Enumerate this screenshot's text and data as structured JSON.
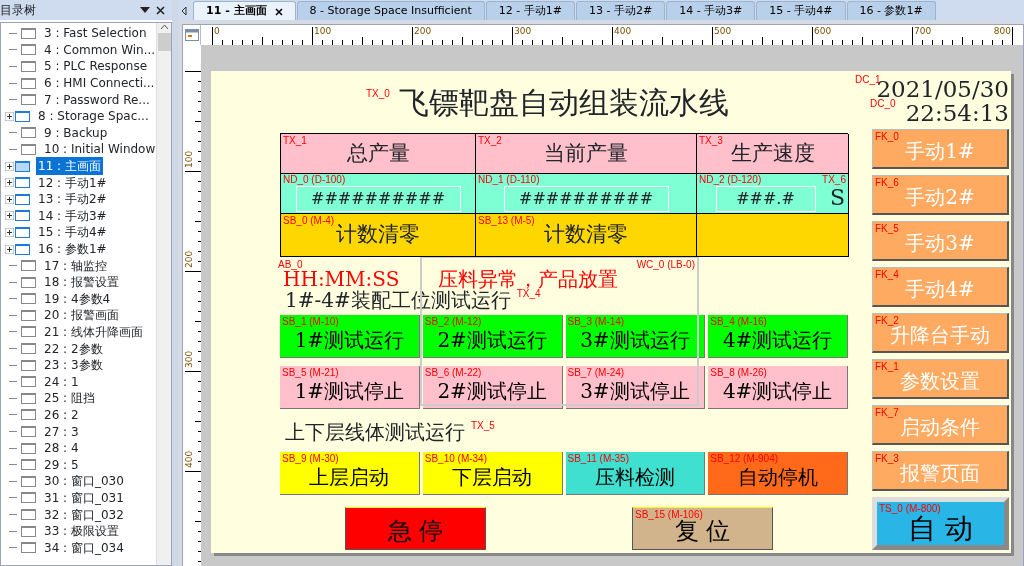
{
  "panel": {
    "title": "目录树",
    "tree": [
      {
        "label": "3 : Fast Selection",
        "expandable": false,
        "selected": false
      },
      {
        "label": "4 : Common Win...",
        "expandable": false,
        "selected": false
      },
      {
        "label": "5 : PLC Response",
        "expandable": false,
        "selected": false
      },
      {
        "label": "6 : HMI Connecti...",
        "expandable": false,
        "selected": false
      },
      {
        "label": "7 : Password Re...",
        "expandable": false,
        "selected": false
      },
      {
        "label": "8 : Storage Spac...",
        "expandable": true,
        "selected": false
      },
      {
        "label": "9 : Backup",
        "expandable": false,
        "selected": false
      },
      {
        "label": "10 : Initial Window",
        "expandable": false,
        "selected": false
      },
      {
        "label": "11 : 主画面",
        "expandable": true,
        "selected": true
      },
      {
        "label": "12 : 手动1#",
        "expandable": true,
        "selected": false
      },
      {
        "label": "13 : 手动2#",
        "expandable": true,
        "selected": false
      },
      {
        "label": "14 : 手动3#",
        "expandable": true,
        "selected": false
      },
      {
        "label": "15 : 手动4#",
        "expandable": true,
        "selected": false
      },
      {
        "label": "16 : 参数1#",
        "expandable": true,
        "selected": false
      },
      {
        "label": "17 : 轴监控",
        "expandable": false,
        "selected": false
      },
      {
        "label": "18 : 报警设置",
        "expandable": false,
        "selected": false
      },
      {
        "label": "19 : 4参数4",
        "expandable": false,
        "selected": false
      },
      {
        "label": "20 : 报警画面",
        "expandable": false,
        "selected": false
      },
      {
        "label": "21 : 线体升降画面",
        "expandable": false,
        "selected": false
      },
      {
        "label": "22 : 2参数",
        "expandable": false,
        "selected": false
      },
      {
        "label": "23 : 3参数",
        "expandable": false,
        "selected": false
      },
      {
        "label": "24 : 1",
        "expandable": false,
        "selected": false
      },
      {
        "label": "25 : 阻挡",
        "expandable": false,
        "selected": false
      },
      {
        "label": "26 : 2",
        "expandable": false,
        "selected": false
      },
      {
        "label": "27 : 3",
        "expandable": false,
        "selected": false
      },
      {
        "label": "28 : 4",
        "expandable": false,
        "selected": false
      },
      {
        "label": "29 : 5",
        "expandable": false,
        "selected": false
      },
      {
        "label": "30 : 窗口_030",
        "expandable": false,
        "selected": false
      },
      {
        "label": "31 : 窗口_031",
        "expandable": false,
        "selected": false
      },
      {
        "label": "32 : 窗口_032",
        "expandable": false,
        "selected": false
      },
      {
        "label": "33 : 极限设置",
        "expandable": false,
        "selected": false
      },
      {
        "label": "34 : 窗口_034",
        "expandable": false,
        "selected": false
      }
    ]
  },
  "tabs": [
    {
      "label": "11 - 主画面",
      "selected": true
    },
    {
      "label": "8 - Storage Space Insufficient",
      "selected": false
    },
    {
      "label": "12 - 手动1#",
      "selected": false
    },
    {
      "label": "13 - 手动2#",
      "selected": false
    },
    {
      "label": "14 - 手动3#",
      "selected": false
    },
    {
      "label": "15 - 手动4#",
      "selected": false
    },
    {
      "label": "16 - 参数1#",
      "selected": false
    }
  ],
  "ruler": {
    "x_labels": [
      "0",
      "100",
      "200",
      "300",
      "400",
      "500",
      "600",
      "700",
      "800"
    ],
    "y_labels": [
      "100",
      "200",
      "300",
      "400"
    ]
  },
  "screen": {
    "title": {
      "tag": "TX_0",
      "text": "飞镖靶盘自动组装流水线"
    },
    "table": {
      "headers": [
        {
          "tag": "TX_1",
          "text": "总产量"
        },
        {
          "tag": "TX_2",
          "text": "当前产量"
        },
        {
          "tag": "TX_3",
          "text": "生产速度"
        }
      ],
      "displays": [
        {
          "tag": "ND_0 (D-100)",
          "value": "##########"
        },
        {
          "tag": "ND_1 (D-110)",
          "value": "##########"
        },
        {
          "tag": "ND_2 (D-120)",
          "value": "###.#",
          "unit": "S",
          "unit_tag": "TX_6"
        }
      ],
      "clear_buttons": [
        {
          "tag": "SB_0 (M-4)",
          "label": "计数清零"
        },
        {
          "tag": "SB_13 (M-5)",
          "label": "计数清零"
        }
      ]
    },
    "alarm": {
      "tag": "AB_0",
      "clock": "HH:MM:SS",
      "message": "压料异常，产品放置"
    },
    "frame_tag": "WC_0 (LB-0)",
    "sections": [
      {
        "tag": "TX_4",
        "heading": "1#-4#装配工位测试运行",
        "rows": [
          [
            {
              "tag": "SB_1 (M-10)",
              "label": "1#测试运行",
              "color": "#00ff00"
            },
            {
              "tag": "SB_2 (M-12)",
              "label": "2#测试运行",
              "color": "#00ff00"
            },
            {
              "tag": "SB_3 (M-14)",
              "label": "3#测试运行",
              "color": "#00ff00"
            },
            {
              "tag": "SB_4 (M-16)",
              "label": "4#测试运行",
              "color": "#00ff00"
            }
          ],
          [
            {
              "tag": "SB_5 (M-21)",
              "label": "1#测试停止",
              "color": "#ffc0cb"
            },
            {
              "tag": "SB_6 (M-22)",
              "label": "2#测试停止",
              "color": "#ffc0cb"
            },
            {
              "tag": "SB_7 (M-24)",
              "label": "3#测试停止",
              "color": "#ffc0cb"
            },
            {
              "tag": "SB_8 (M-26)",
              "label": "4#测试停止",
              "color": "#ffc0cb"
            }
          ]
        ]
      },
      {
        "tag": "TX_5",
        "heading": "上下层线体测试运行",
        "rows": [
          [
            {
              "tag": "SB_9 (M-30)",
              "label": "上层启动",
              "color": "#ffff00"
            },
            {
              "tag": "SB_10 (M-34)",
              "label": "下层启动",
              "color": "#ffff00"
            },
            {
              "tag": "SB_11 (M-35)",
              "label": "压料检测",
              "color": "#40e0d0"
            },
            {
              "tag": "SB_12 (M-904)",
              "label": "自动停机",
              "color": "#ff6a1a"
            }
          ]
        ]
      }
    ],
    "bottom_buttons": [
      {
        "label": "急 停",
        "color": "#ff0000"
      },
      {
        "tag": "SB_15 (M-106)",
        "label": "复 位",
        "color": "#d2b48c"
      }
    ],
    "date": {
      "tag": "DC_1",
      "text": "2021/05/30"
    },
    "time": {
      "tag": "DC_0",
      "text": "22:54:13"
    },
    "nav_buttons": [
      {
        "tag": "FK_0",
        "label": "手动1#"
      },
      {
        "tag": "FK_6",
        "label": "手动2#"
      },
      {
        "tag": "FK_5",
        "label": "手动3#"
      },
      {
        "tag": "FK_4",
        "label": "手动4#"
      },
      {
        "tag": "FK_2",
        "label": "升降台手动"
      },
      {
        "tag": "FK_1",
        "label": "参数设置"
      },
      {
        "tag": "FK_7",
        "label": "启动条件"
      },
      {
        "tag": "FK_3",
        "label": "报警页面"
      }
    ],
    "auto_button": {
      "tag": "TS_0 (M-800)",
      "label": "自 动"
    }
  }
}
